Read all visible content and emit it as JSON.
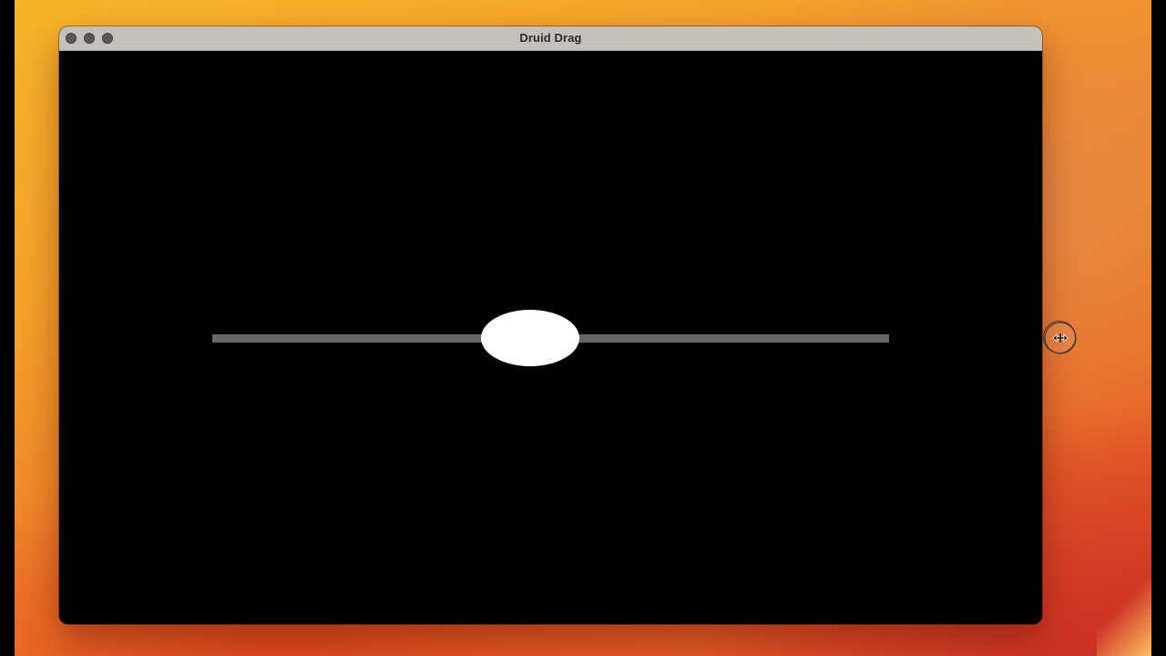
{
  "window": {
    "title": "Druid Drag",
    "buttons": [
      "close",
      "minimize",
      "zoom"
    ]
  },
  "slider": {
    "value": 0.47
  },
  "cursor": {
    "icon": "resize-horizontal-cursor-icon"
  },
  "colors": {
    "track": "#666666",
    "thumb": "#ffffff",
    "canvas": "#000000",
    "titlebar": "#c5c0ba"
  }
}
